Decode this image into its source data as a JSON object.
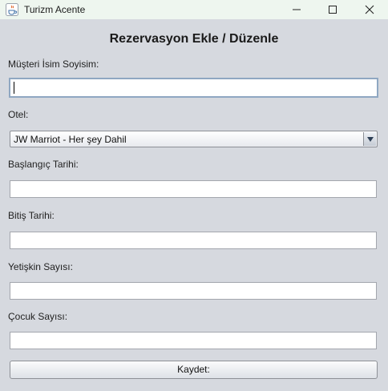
{
  "window": {
    "title": "Turizm Acente",
    "icon": "java-cup-icon",
    "controls": [
      "minimize-icon",
      "maximize-icon",
      "close-icon"
    ]
  },
  "form": {
    "heading": "Rezervasyon Ekle / Düzenle",
    "customer_label": "Müşteri İsim Soyisim:",
    "customer_value": "",
    "hotel_label": "Otel:",
    "hotel_selected": "JW Marriot - Her şey Dahil",
    "start_label": "Başlangıç Tarihi:",
    "start_value": "",
    "end_label": "Bitiş Tarihi:",
    "end_value": "",
    "adults_label": "Yetişkin Sayısı:",
    "adults_value": "",
    "children_label": "Çocuk Sayısı:",
    "children_value": "",
    "save_label": "Kaydet:"
  }
}
